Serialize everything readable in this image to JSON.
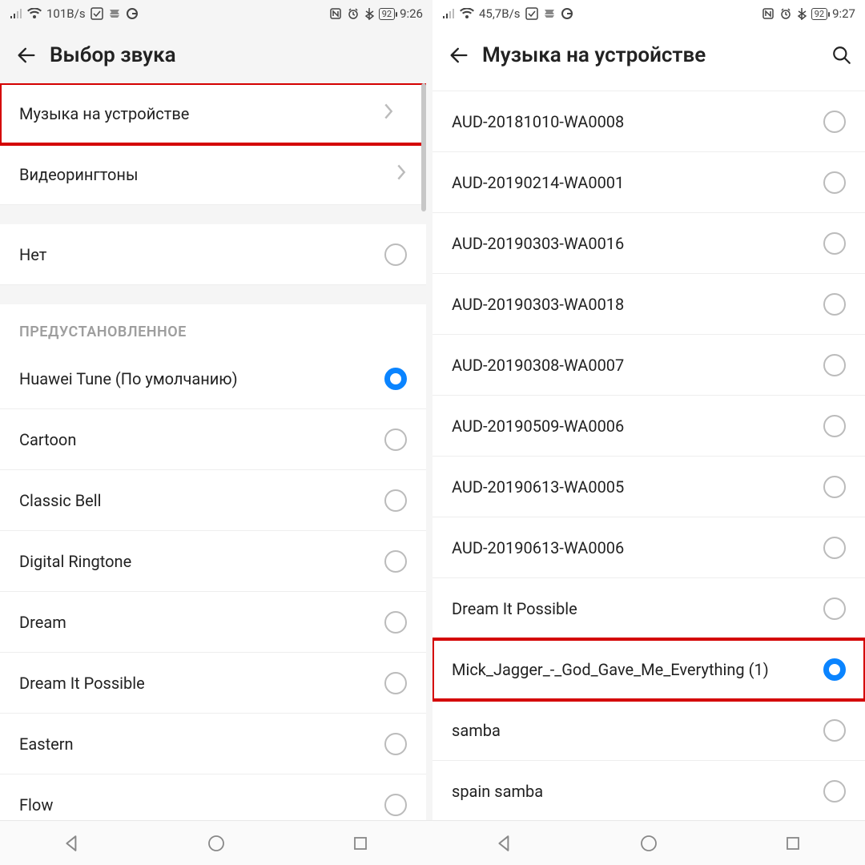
{
  "left": {
    "status": {
      "speed": "101B/s",
      "battery": "92",
      "time": "9:26"
    },
    "title": "Выбор звука",
    "nav_items": [
      {
        "label": "Музыка на устройстве",
        "highlight": true
      },
      {
        "label": "Видеорингтоны",
        "highlight": false
      }
    ],
    "none_label": "Нет",
    "preset_header": "ПРЕДУСТАНОВЛЕННОЕ",
    "presets": [
      {
        "label": "Huawei Tune (По умолчанию)",
        "selected": true
      },
      {
        "label": "Cartoon",
        "selected": false
      },
      {
        "label": "Classic Bell",
        "selected": false
      },
      {
        "label": "Digital Ringtone",
        "selected": false
      },
      {
        "label": "Dream",
        "selected": false
      },
      {
        "label": "Dream It Possible",
        "selected": false
      },
      {
        "label": "Eastern",
        "selected": false
      },
      {
        "label": "Flow",
        "selected": false
      }
    ]
  },
  "right": {
    "status": {
      "speed": "45,7B/s",
      "battery": "92",
      "time": "9:27"
    },
    "title": "Музыка на устройстве",
    "tracks": [
      {
        "label": "AUD-20181010-WA0008",
        "selected": false,
        "highlight": false
      },
      {
        "label": "AUD-20190214-WA0001",
        "selected": false,
        "highlight": false
      },
      {
        "label": "AUD-20190303-WA0016",
        "selected": false,
        "highlight": false
      },
      {
        "label": "AUD-20190303-WA0018",
        "selected": false,
        "highlight": false
      },
      {
        "label": "AUD-20190308-WA0007",
        "selected": false,
        "highlight": false
      },
      {
        "label": "AUD-20190509-WA0006",
        "selected": false,
        "highlight": false
      },
      {
        "label": "AUD-20190613-WA0005",
        "selected": false,
        "highlight": false
      },
      {
        "label": "AUD-20190613-WA0006",
        "selected": false,
        "highlight": false
      },
      {
        "label": "Dream It Possible",
        "selected": false,
        "highlight": false
      },
      {
        "label": "Mick_Jagger_-_God_Gave_Me_Everything (1)",
        "selected": true,
        "highlight": true
      },
      {
        "label": "samba",
        "selected": false,
        "highlight": false
      },
      {
        "label": "spain samba",
        "selected": false,
        "highlight": false
      }
    ]
  }
}
